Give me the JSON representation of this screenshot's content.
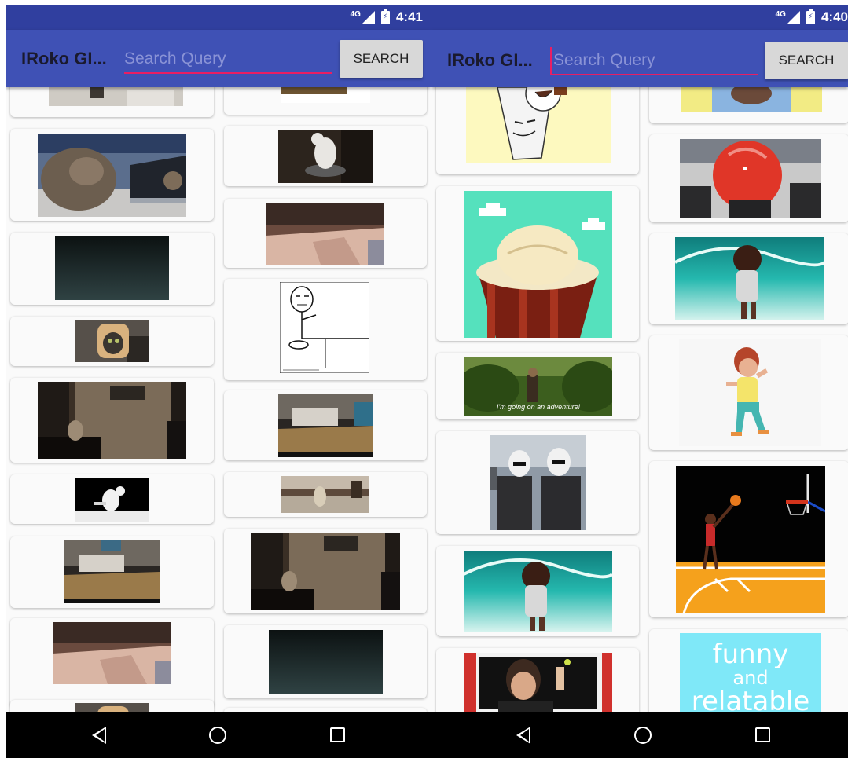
{
  "screens": [
    {
      "status": {
        "network": "4G",
        "time": "4:41"
      },
      "toolbar": {
        "title": "IRoko GI...",
        "search_placeholder": "Search Query",
        "search_value": "",
        "search_label": "SEARCH"
      },
      "results": [
        {
          "name": "gif-cat-partial-top"
        },
        {
          "name": "gif-cat-laptop"
        },
        {
          "name": "gif-dark-room"
        },
        {
          "name": "gif-cat-bread"
        },
        {
          "name": "gif-cat-corner"
        },
        {
          "name": "gif-cat-table"
        },
        {
          "name": "gif-box-floor"
        },
        {
          "name": "gif-bed-blanket"
        },
        {
          "name": "gif-cat-bread-partial"
        },
        {
          "name": "gif-partial-top-right"
        },
        {
          "name": "gif-cat-roomba"
        },
        {
          "name": "gif-bed-room"
        },
        {
          "name": "gif-rage-comic-cereal"
        },
        {
          "name": "gif-box-floor-2"
        },
        {
          "name": "gif-cat-standing"
        },
        {
          "name": "gif-cat-corner-2"
        },
        {
          "name": "gif-dark-room-2"
        },
        {
          "name": "gif-partial-bottom"
        }
      ]
    },
    {
      "status": {
        "network": "4G",
        "time": "4:40"
      },
      "toolbar": {
        "title": "IRoko GI...",
        "search_placeholder": "Search Query",
        "search_value": "",
        "search_label": "SEARCH"
      },
      "results": [
        {
          "name": "gif-cartoon-cup"
        },
        {
          "name": "gif-pixel-ice-cream"
        },
        {
          "name": "gif-adventure",
          "caption": "I'm going on an adventure!"
        },
        {
          "name": "gif-stormtroopers"
        },
        {
          "name": "gif-wave-dancer"
        },
        {
          "name": "gif-dance-teacher"
        },
        {
          "name": "gif-blue-shirt-partial"
        },
        {
          "name": "gif-red-ball"
        },
        {
          "name": "gif-wave-dancer-2"
        },
        {
          "name": "gif-cartoon-dancer"
        },
        {
          "name": "gif-basketball"
        },
        {
          "name": "gif-funny-relatable",
          "lines": [
            "funny",
            "and",
            "relatable"
          ]
        }
      ]
    }
  ],
  "navigation": {
    "back": "back-icon",
    "home": "home-icon",
    "recents": "recents-icon"
  },
  "colors": {
    "status_bar": "#303f9f",
    "toolbar": "#3f51b5",
    "accent": "#e91e63",
    "button": "#d8d8d8"
  }
}
